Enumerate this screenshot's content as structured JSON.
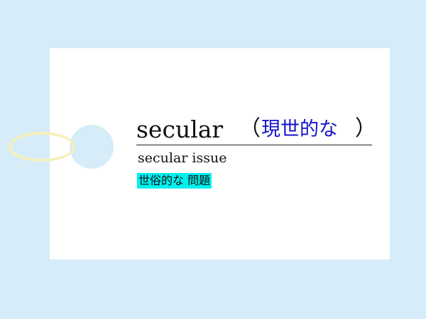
{
  "card": {
    "word": "secular",
    "paren_open": "（",
    "meaning": "現世的な",
    "paren_close": "）",
    "example": "secular issue",
    "example_translation": "世俗的な 問題"
  },
  "colors": {
    "background": "#d6ecf8",
    "card": "#ffffff",
    "meaning_text": "#1414c8",
    "translation_highlight": "#00f0f0",
    "ring": "#f6f0bc"
  }
}
